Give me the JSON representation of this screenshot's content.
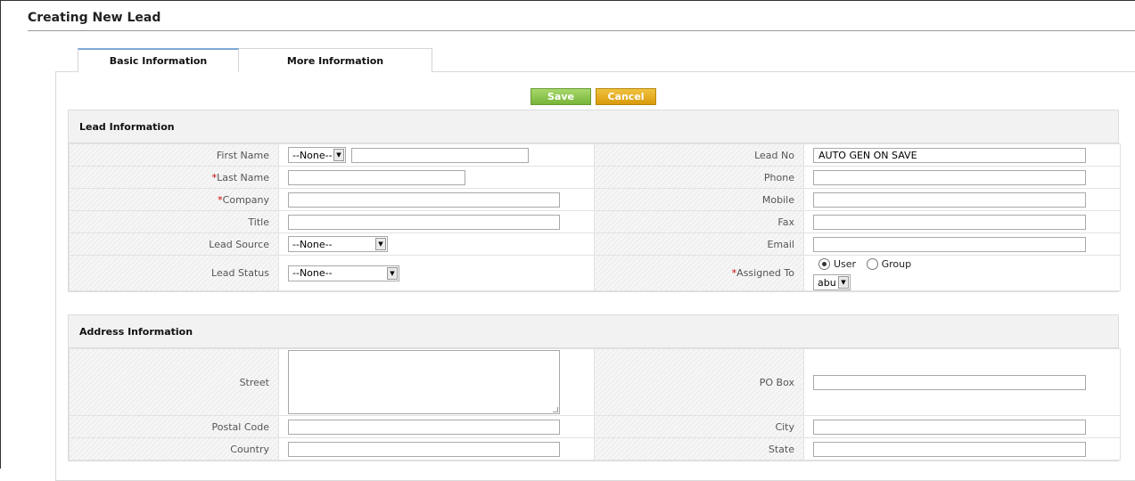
{
  "page": {
    "title": "Creating New Lead"
  },
  "tabs": [
    {
      "label": "Basic Information",
      "active": true
    },
    {
      "label": "More Information",
      "active": false
    }
  ],
  "actions": {
    "save_label": "Save",
    "cancel_label": "Cancel"
  },
  "colors": {
    "save": "#8cc54c",
    "cancel": "#e6ab1c",
    "required": "#cc0000",
    "tab_accent": "#7fa8d6"
  },
  "lead_info": {
    "header": "Lead Information",
    "first_name_label": "First Name",
    "salutation_value": "--None--",
    "first_name_value": "",
    "last_name_label": "Last Name",
    "last_name_value": "",
    "company_label": "Company",
    "company_value": "",
    "title_label": "Title",
    "title_value": "",
    "lead_source_label": "Lead Source",
    "lead_source_value": "--None--",
    "lead_status_label": "Lead Status",
    "lead_status_value": "--None--",
    "lead_no_label": "Lead No",
    "lead_no_value": "AUTO GEN ON SAVE",
    "phone_label": "Phone",
    "phone_value": "",
    "mobile_label": "Mobile",
    "mobile_value": "",
    "fax_label": "Fax",
    "fax_value": "",
    "email_label": "Email",
    "email_value": "",
    "assigned_to_label": "Assigned To",
    "assign_user_label": "User",
    "assign_group_label": "Group",
    "assigned_user_value": "abu",
    "required_marker": "*"
  },
  "address_info": {
    "header": "Address Information",
    "street_label": "Street",
    "street_value": "",
    "po_box_label": "PO Box",
    "po_box_value": "",
    "postal_code_label": "Postal Code",
    "postal_code_value": "",
    "city_label": "City",
    "city_value": "",
    "country_label": "Country",
    "country_value": "",
    "state_label": "State",
    "state_value": ""
  }
}
